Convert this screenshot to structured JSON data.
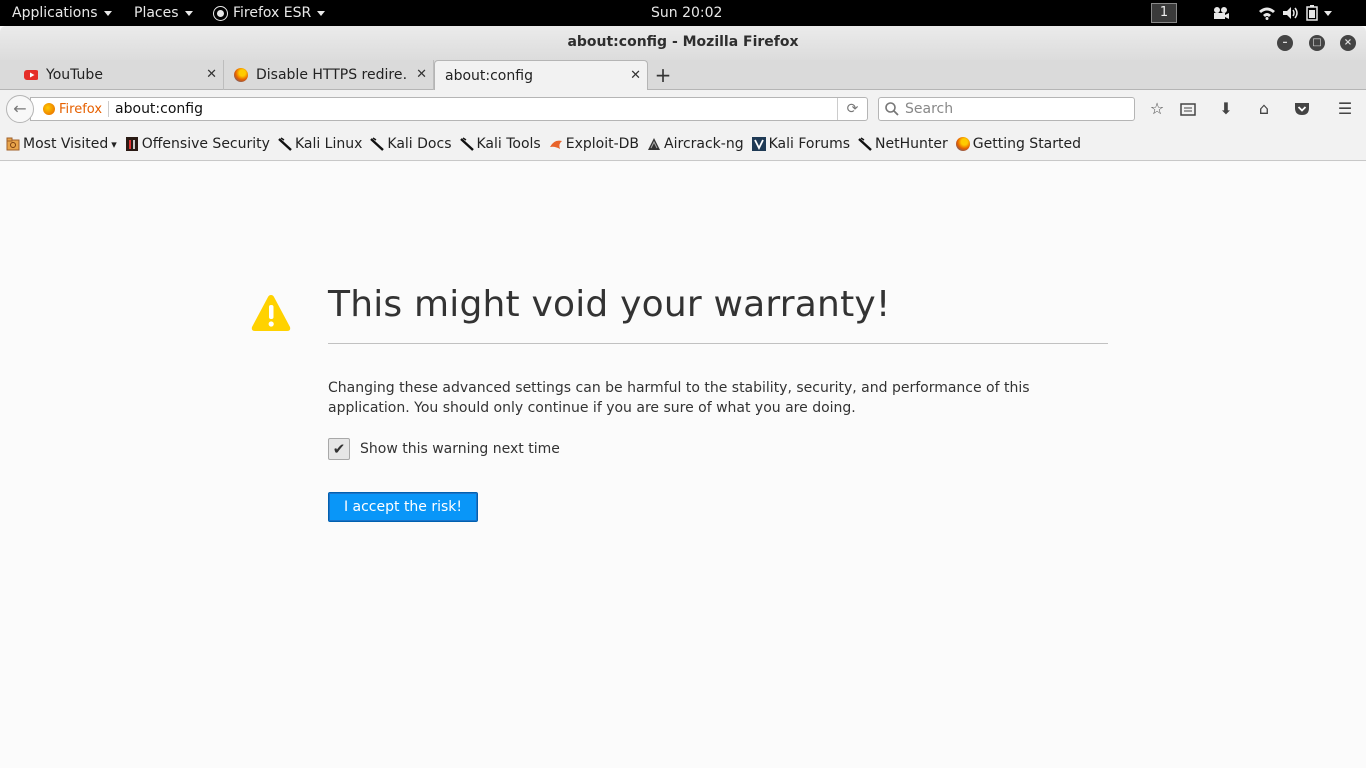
{
  "topbar": {
    "applications": "Applications",
    "places": "Places",
    "app_name": "Firefox ESR",
    "clock": "Sun 20:02",
    "workspace": "1"
  },
  "window": {
    "title": "about:config - Mozilla Firefox"
  },
  "tabs": [
    {
      "label": "YouTube",
      "icon": "youtube-icon"
    },
    {
      "label": "Disable HTTPS redire…",
      "icon": "firefox-icon"
    },
    {
      "label": "about:config",
      "icon": null
    }
  ],
  "navbar": {
    "identity_label": "Firefox",
    "url": "about:config",
    "search_placeholder": "Search"
  },
  "bookmarks": [
    {
      "label": "Most Visited",
      "icon": "folder-icon"
    },
    {
      "label": "Offensive Security",
      "icon": "offsec-icon"
    },
    {
      "label": "Kali Linux",
      "icon": "kali-icon"
    },
    {
      "label": "Kali Docs",
      "icon": "kali-icon"
    },
    {
      "label": "Kali Tools",
      "icon": "kali-icon"
    },
    {
      "label": "Exploit-DB",
      "icon": "exploitdb-icon"
    },
    {
      "label": "Aircrack-ng",
      "icon": "aircrack-icon"
    },
    {
      "label": "Kali Forums",
      "icon": "forums-icon"
    },
    {
      "label": "NetHunter",
      "icon": "kali-icon"
    },
    {
      "label": "Getting Started",
      "icon": "firefox-icon"
    }
  ],
  "warning": {
    "title": "This might void your warranty!",
    "message": "Changing these advanced settings can be harmful to the stability, security, and performance of this application. You should only continue if you are sure of what you are doing.",
    "checkbox_label": "Show this warning next time",
    "checkbox_checked": true,
    "accept_label": "I accept the risk!"
  },
  "colors": {
    "accent": "#0996f8",
    "warning": "#ffd200",
    "firefox_orange": "#e66000"
  }
}
